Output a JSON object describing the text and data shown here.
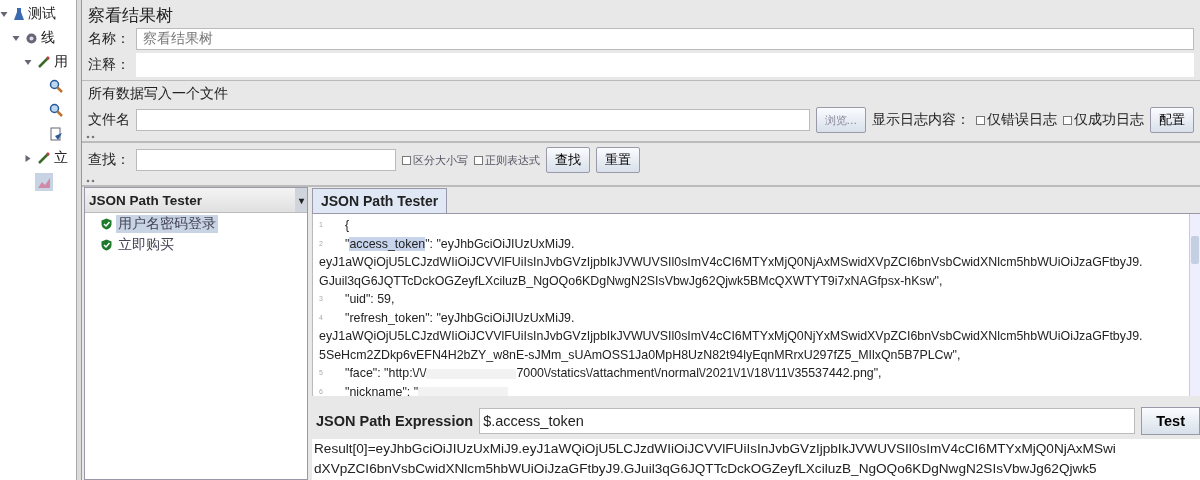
{
  "nav_tree": [
    {
      "kind": "plan",
      "label": "测试",
      "expanded": true,
      "children": [
        {
          "kind": "threads",
          "label": "线",
          "expanded": true,
          "children": [
            {
              "kind": "sampler",
              "label": "用",
              "expanded": true,
              "children": [
                {
                  "kind": "extractor",
                  "selected": false
                },
                {
                  "kind": "extractor",
                  "selected": false
                },
                {
                  "kind": "assertion",
                  "selected": false
                }
              ]
            },
            {
              "kind": "sampler",
              "label": "立",
              "expanded": false
            },
            {
              "kind": "listener",
              "selected": true
            }
          ]
        }
      ]
    }
  ],
  "panel": {
    "title": "察看结果树",
    "name_label": "名称：",
    "name_value": "察看结果树",
    "comment_label": "注释：",
    "file_group": "所有数据写入一个文件",
    "file_label": "文件名",
    "browse": "浏览...",
    "log_label": "显示日志内容：",
    "log_options": [
      {
        "label": "仅错误日志",
        "checked": false
      },
      {
        "label": "仅成功日志",
        "checked": false
      }
    ],
    "config": "配置"
  },
  "search": {
    "label": "查找：",
    "options": [
      {
        "label": "区分大小写",
        "checked": false
      },
      {
        "label": "正则表达式",
        "checked": false
      }
    ],
    "find": "查找",
    "reset": "重置"
  },
  "renderer": {
    "selected": "JSON Path Tester",
    "caret": "▾"
  },
  "samples": [
    {
      "label": "用户名密码登录",
      "selected": true
    },
    {
      "label": "立即购买",
      "selected": false
    }
  ],
  "tab": {
    "label": "JSON Path Tester",
    "selected": true
  },
  "code_lines": [
    {
      "number": "1",
      "parts": [
        {
          "kind": "text",
          "text": "{"
        }
      ]
    },
    {
      "number": "2",
      "parts": [
        {
          "kind": "text",
          "text": "    \""
        },
        {
          "kind": "highlight",
          "text": "access_token"
        },
        {
          "kind": "text",
          "text": "\": \"eyJhbGciOiJIUzUxMiJ9."
        }
      ],
      "wrapped": [
        "eyJ1aWQiOjU5LCJzdWIiOiJCVVlFUiIsInJvbGVzIjpbIkJVWUVSIl0sImV4cCI6MTYxMjQ0NjAxMSwidXVpZCI6bnVsbCwidXNlcm5hbWUiOiJzaGFtbyJ9.",
        "GJuil3qG6JQTTcDckOGZeyfLXciluzB_NgOQo6KDgNwgN2SIsVbwJg62Qjwk5BMcQXWTYT9i7xNAGfpsx-hKsw\","
      ]
    },
    {
      "number": "3",
      "parts": [
        {
          "kind": "text",
          "text": "    \"uid\": 59,"
        }
      ]
    },
    {
      "number": "4",
      "parts": [
        {
          "kind": "text",
          "text": "    \"refresh_token\": \"eyJhbGciOiJIUzUxMiJ9."
        }
      ],
      "wrapped": [
        "eyJ1aWQiOjU5LCJzdWIiOiJCVVlFUiIsInJvbGVzIjpbIkJVWUVSIl0sImV4cCI6MTYxMjQ0NjYxMSwidXVpZCI6bnVsbCwidXNlcm5hbWUiOiJzaGFtbyJ9.",
        "5SeHcm2ZDkp6vEFN4H2bZY_w8nE-sJMm_sUAmOSS1Ja0MpH8UzN82t94lyEqnMRrxU297fZ5_MIlxQn5B7PLCw\","
      ]
    },
    {
      "number": "5",
      "parts": [
        {
          "kind": "text",
          "text": "    \"face\": \"http:\\/\\/"
        },
        {
          "kind": "redacted"
        },
        {
          "kind": "text",
          "text": "7000\\/statics\\/attachment\\/normal\\/2021\\/1\\/18\\/11\\/35537442.png\","
        }
      ]
    },
    {
      "number": "6",
      "parts": [
        {
          "kind": "text",
          "text": "    \"nickname\": \""
        },
        {
          "kind": "redacted"
        }
      ]
    }
  ],
  "expression": {
    "label": "JSON Path Expression",
    "value": "$.access_token",
    "button": "Test"
  },
  "result_lines": [
    "Result[0]=eyJhbGciOiJIUzUxMiJ9.eyJ1aWQiOjU5LCJzdWIiOiJCVVlFUiIsInJvbGVzIjpbIkJVWUVSIl0sImV4cCI6MTYxMjQ0NjAxMSwi",
    "dXVpZCI6bnVsbCwidXNlcm5hbWUiOiJzaGFtbyJ9.GJuil3qG6JQTTcDckOGZeyfLXciluzB_NgOQo6KDgNwgN2SIsVbwJg62Qjwk5"
  ]
}
